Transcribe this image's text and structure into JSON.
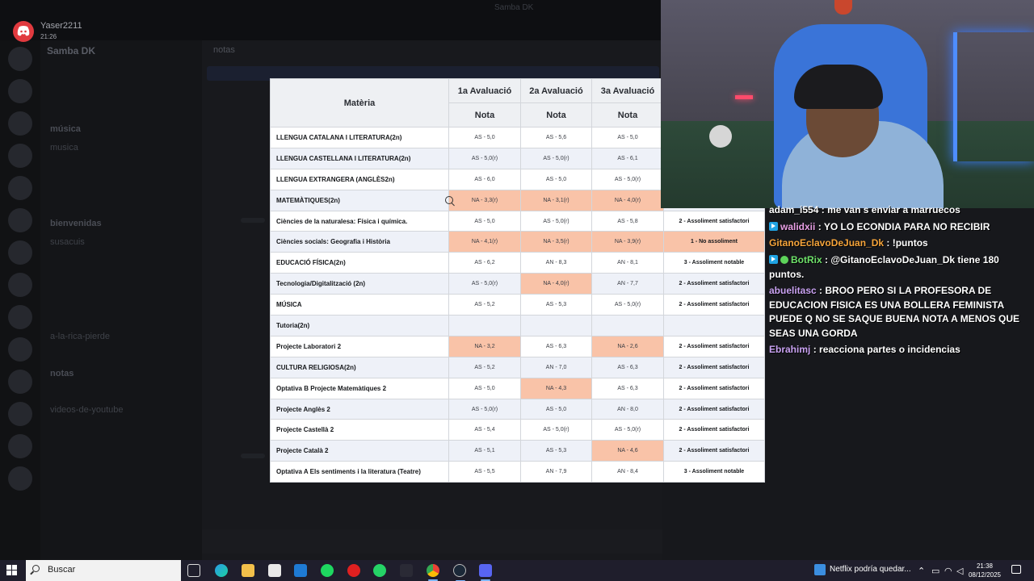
{
  "notification": {
    "user": "Yaser2211",
    "time": "21:26"
  },
  "discord": {
    "server_name": "Samba DK",
    "channel_header": "notas",
    "window_title": "Samba DK",
    "channels": [
      {
        "label": "música",
        "category": true
      },
      {
        "label": "musica",
        "category": false
      },
      {
        "label": "bienvenidas",
        "category": true
      },
      {
        "label": "susacuis",
        "category": false
      },
      {
        "label": "a-la-rica-pierde",
        "category": false
      },
      {
        "label": "notas",
        "category": true
      },
      {
        "label": "videos-de-youtube",
        "category": false
      }
    ]
  },
  "grades": {
    "header_subject": "Matèria",
    "evaluations": [
      "1a Avaluació",
      "2a Avaluació",
      "3a Avaluació"
    ],
    "sub_header": "Nota",
    "rows": [
      {
        "subject": "LLENGUA CATALANA I LITERATURA(2n)",
        "g1": "AS - 5,0",
        "g2": "AS - 5,6",
        "g3": "AS - 5,0",
        "result": "",
        "fail": [
          false,
          false,
          false,
          false
        ]
      },
      {
        "subject": "LLENGUA CASTELLANA I LITERATURA(2n)",
        "g1": "AS - 5,0(r)",
        "g2": "AS - 5,0(r)",
        "g3": "AS - 6,1",
        "result": "",
        "fail": [
          false,
          false,
          false,
          false
        ]
      },
      {
        "subject": "LLENGUA EXTRANGERA (ANGLÈS2n)",
        "g1": "AS - 6,0",
        "g2": "AS - 5,0",
        "g3": "AS - 5,0(r)",
        "result": "",
        "fail": [
          false,
          false,
          false,
          false
        ]
      },
      {
        "subject": "MATEMÀTIQUES(2n)",
        "g1": "NA - 3,3(r)",
        "g2": "NA - 3,1(r)",
        "g3": "NA - 4,0(r)",
        "result": "",
        "fail": [
          true,
          true,
          true,
          false
        ]
      },
      {
        "subject": "Ciències de la naturalesa: Física i química.",
        "g1": "AS - 5,0",
        "g2": "AS - 5,0(r)",
        "g3": "AS - 5,8",
        "result": "2 - Assoliment satisfactori",
        "fail": [
          false,
          false,
          false,
          false
        ]
      },
      {
        "subject": "Ciències socials: Geografia i Història",
        "g1": "NA - 4,1(r)",
        "g2": "NA - 3,5(r)",
        "g3": "NA - 3,9(r)",
        "result": "1 - No assoliment",
        "fail": [
          true,
          true,
          true,
          true
        ]
      },
      {
        "subject": "EDUCACIÓ FÍSICA(2n)",
        "g1": "AS - 6,2",
        "g2": "AN - 8,3",
        "g3": "AN - 8,1",
        "result": "3 - Assoliment notable",
        "fail": [
          false,
          false,
          false,
          false
        ]
      },
      {
        "subject": "Tecnologia/Digitalització (2n)",
        "g1": "AS - 5,0(r)",
        "g2": "NA - 4,0(r)",
        "g3": "AN - 7,7",
        "result": "2 - Assoliment satisfactori",
        "fail": [
          false,
          true,
          false,
          false
        ]
      },
      {
        "subject": "MÚSICA",
        "g1": "AS - 5,2",
        "g2": "AS - 5,3",
        "g3": "AS - 5,0(r)",
        "result": "2 - Assoliment satisfactori",
        "fail": [
          false,
          false,
          false,
          false
        ]
      },
      {
        "subject": "Tutoria(2n)",
        "g1": "",
        "g2": "",
        "g3": "",
        "result": "",
        "fail": [
          false,
          false,
          false,
          false
        ]
      },
      {
        "subject": "Projecte Laboratori 2",
        "g1": "NA - 3,2",
        "g2": "AS - 6,3",
        "g3": "NA - 2,6",
        "result": "2 - Assoliment satisfactori",
        "fail": [
          true,
          false,
          true,
          false
        ]
      },
      {
        "subject": "CULTURA RELIGIOSA(2n)",
        "g1": "AS - 5,2",
        "g2": "AN - 7,0",
        "g3": "AS - 6,3",
        "result": "2 - Assoliment satisfactori",
        "fail": [
          false,
          false,
          false,
          false
        ]
      },
      {
        "subject": "Optativa B Projecte Matemàtiques 2",
        "g1": "AS - 5,0",
        "g2": "NA - 4,3",
        "g3": "AS - 6,3",
        "result": "2 - Assoliment satisfactori",
        "fail": [
          false,
          true,
          false,
          false
        ]
      },
      {
        "subject": "Projecte Anglès 2",
        "g1": "AS - 5,0(r)",
        "g2": "AS - 5,0",
        "g3": "AN - 8,0",
        "result": "2 - Assoliment satisfactori",
        "fail": [
          false,
          false,
          false,
          false
        ]
      },
      {
        "subject": "Projecte Castellà 2",
        "g1": "AS - 5,4",
        "g2": "AS - 5,0(r)",
        "g3": "AS - 5,0(r)",
        "result": "2 - Assoliment satisfactori",
        "fail": [
          false,
          false,
          false,
          false
        ]
      },
      {
        "subject": "Projecte Català 2",
        "g1": "AS - 5,1",
        "g2": "AS - 5,3",
        "g3": "NA - 4,6",
        "result": "2 - Assoliment satisfactori",
        "fail": [
          false,
          false,
          true,
          false
        ]
      },
      {
        "subject": "Optativa A Els sentiments i la literatura (Teatre)",
        "g1": "AS - 5,5",
        "g2": "AN - 7,9",
        "g3": "AN - 8,4",
        "result": "3 - Assoliment notable",
        "fail": [
          false,
          false,
          false,
          false
        ]
      }
    ]
  },
  "chat": [
    {
      "user": "adam_i554",
      "badge": "",
      "color": "#ffffff",
      "text": "me van s enviar a marruecos"
    },
    {
      "user": "walidxii",
      "badge": "prime",
      "color": "#e9a0e6",
      "text": "YO LO ECONDIA PARA NO RECIBIR"
    },
    {
      "user": "GitanoEclavoDeJuan_Dk",
      "badge": "",
      "color": "#f6a43a",
      "text": "!puntos"
    },
    {
      "user": "BotRix",
      "badge": "prime-verified",
      "color": "#6ee16a",
      "text": "@GitanoEclavoDeJuan_Dk tiene 180 puntos."
    },
    {
      "user": "abuelitasc",
      "badge": "",
      "color": "#c9a2f2",
      "text": "BROO PERO SI LA PROFESORA DE EDUCACION FISICA ES UNA BOLLERA FEMINISTA PUEDE Q NO SE SAQUE BUENA NOTA A MENOS QUE SEAS UNA GORDA"
    },
    {
      "user": "Ebrahimj",
      "badge": "",
      "color": "#c9a2f2",
      "text": "reacciona partes o incidencias"
    }
  ],
  "taskbar": {
    "search_placeholder": "Buscar",
    "news": "Netflix podría quedar...",
    "time": "21:38",
    "date": "08/12/2025",
    "apps": [
      "task-view",
      "edge",
      "file-explorer",
      "store",
      "outlook",
      "spotify",
      "opera",
      "whatsapp",
      "app-d",
      "chrome",
      "steam",
      "discord"
    ]
  }
}
